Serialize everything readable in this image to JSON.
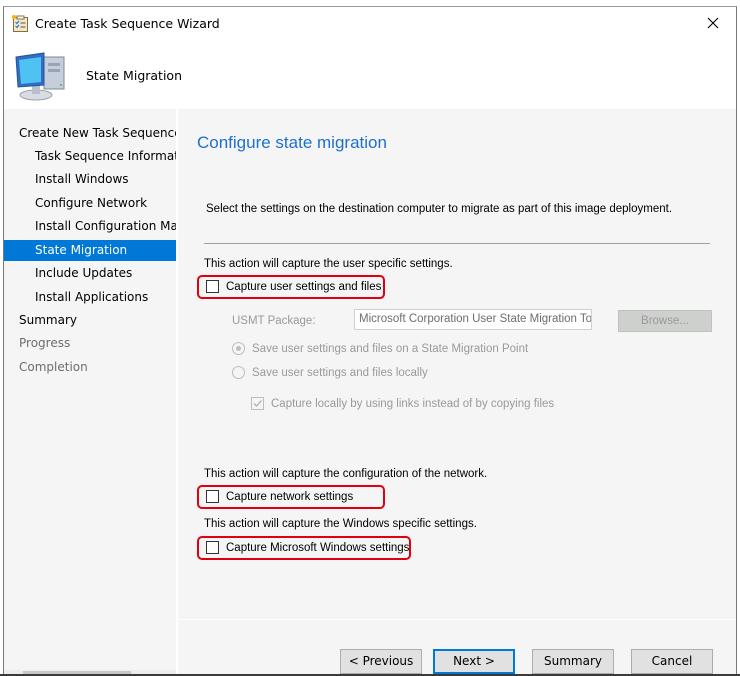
{
  "window": {
    "title": "Create Task Sequence Wizard",
    "close_icon": "close-icon"
  },
  "header": {
    "title": "State Migration",
    "icon": "computer-icon"
  },
  "nav": {
    "items": [
      {
        "label": "Create New Task Sequence",
        "level": 1,
        "state": "normal"
      },
      {
        "label": "Task Sequence Information",
        "level": 2,
        "state": "normal"
      },
      {
        "label": "Install Windows",
        "level": 2,
        "state": "normal"
      },
      {
        "label": "Configure Network",
        "level": 2,
        "state": "normal"
      },
      {
        "label": "Install Configuration Manager",
        "level": 2,
        "state": "normal"
      },
      {
        "label": "State Migration",
        "level": 2,
        "state": "active"
      },
      {
        "label": "Include Updates",
        "level": 2,
        "state": "normal"
      },
      {
        "label": "Install Applications",
        "level": 2,
        "state": "normal"
      },
      {
        "label": "Summary",
        "level": 1,
        "state": "normal"
      },
      {
        "label": "Progress",
        "level": 1,
        "state": "dim"
      },
      {
        "label": "Completion",
        "level": 1,
        "state": "dim"
      }
    ]
  },
  "content": {
    "page_title": "Configure state migration",
    "intro": "Select the settings on the destination computer to migrate as part of this image deployment.",
    "user_section": {
      "description": "This action will capture the user specific settings.",
      "capture_checkbox": {
        "label": "Capture user settings and files",
        "checked": false
      },
      "usmt_label": "USMT Package:",
      "usmt_value": "Microsoft Corporation User State Migration Tool for Windows",
      "browse_label": "Browse...",
      "radio_smp": {
        "label": "Save user settings and files on a State Migration Point",
        "selected": true
      },
      "radio_local": {
        "label": "Save user settings and files locally",
        "selected": false
      },
      "links_checkbox": {
        "label": "Capture locally by using links instead of by copying files",
        "checked": true
      }
    },
    "network_section": {
      "description": "This action will capture the configuration of the network.",
      "capture_checkbox": {
        "label": "Capture network settings",
        "checked": false
      }
    },
    "windows_section": {
      "description": "This action will capture the Windows specific settings.",
      "capture_checkbox": {
        "label": "Capture Microsoft Windows settings",
        "checked": false
      }
    },
    "highlight_color": "#e0000f",
    "title_color": "#1e6fd0"
  },
  "footer": {
    "previous_label": "< Previous",
    "next_label": "Next >",
    "summary_label": "Summary",
    "cancel_label": "Cancel"
  }
}
